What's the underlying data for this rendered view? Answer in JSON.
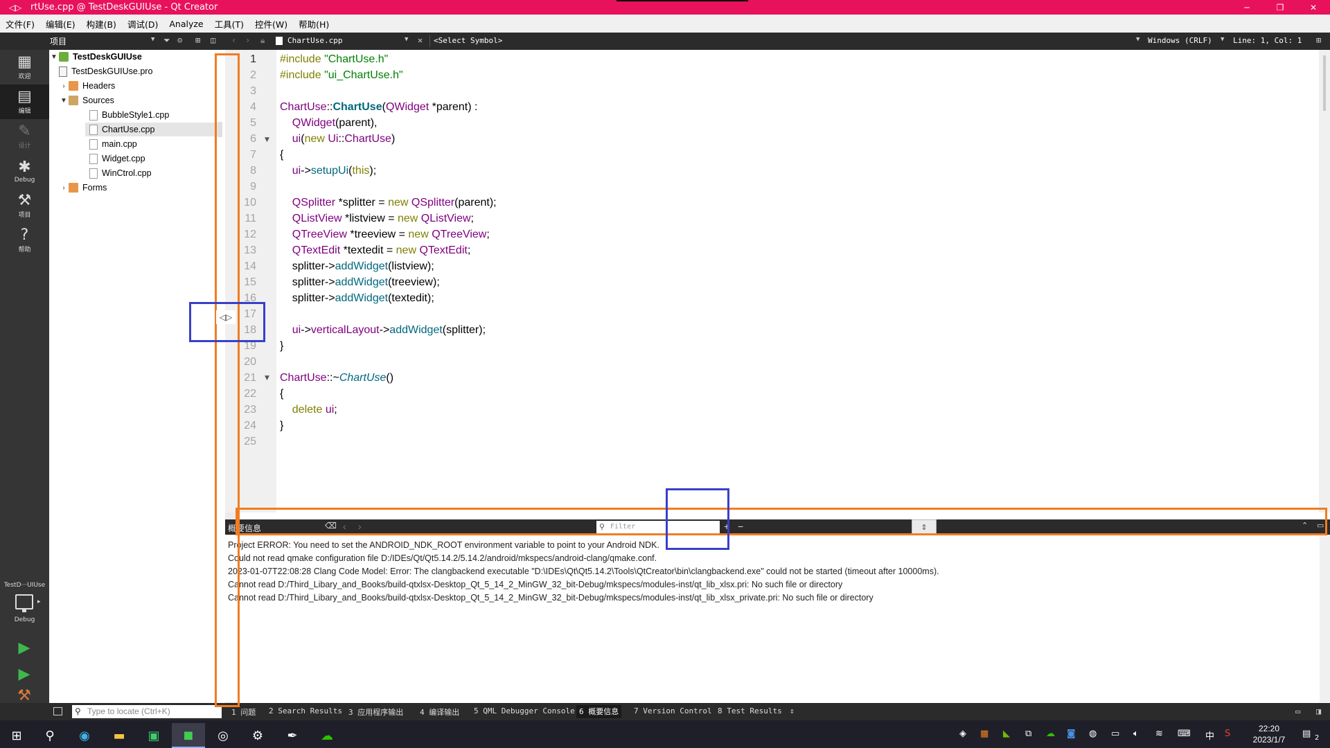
{
  "window": {
    "title": "rtUse.cpp @ TestDeskGUIUse - Qt Creator",
    "app_glyph": "◁▷",
    "minimize": "─",
    "maximize": "❐",
    "close": "✕"
  },
  "menubar": [
    "文件(F)",
    "编辑(E)",
    "构建(B)",
    "调试(D)",
    "Analyze",
    "工具(T)",
    "控件(W)",
    "帮助(H)"
  ],
  "toolbar": {
    "project_combo": "项目",
    "file_combo": "ChartUse.cpp",
    "symbol_combo": "<Select Symbol>",
    "line_ending": "Windows (CRLF)",
    "line_col": "Line: 1, Col: 1"
  },
  "modes": [
    {
      "label": "欢迎",
      "icon": "grid-icon",
      "glyph": "▦"
    },
    {
      "label": "编辑",
      "icon": "edit-doc-icon",
      "glyph": "▤"
    },
    {
      "label": "设计",
      "icon": "pencil-icon",
      "glyph": "✎"
    },
    {
      "label": "Debug",
      "icon": "bug-icon",
      "glyph": "✱"
    },
    {
      "label": "项目",
      "icon": "wrench-icon",
      "glyph": "⚒"
    },
    {
      "label": "帮助",
      "icon": "help-icon",
      "glyph": "?"
    }
  ],
  "kit": {
    "name": "TestD···UIUse",
    "build": "Debug"
  },
  "tree": {
    "project": "TestDeskGUIUse",
    "pro_file": "TestDeskGUIUse.pro",
    "headers": "Headers",
    "sources": "Sources",
    "files": [
      "BubbleStyle1.cpp",
      "ChartUse.cpp",
      "main.cpp",
      "Widget.cpp",
      "WinCtrol.cpp"
    ],
    "forms": "Forms"
  },
  "editor": {
    "line_numbers": [
      "1",
      "2",
      "3",
      "4",
      "5",
      "6",
      "7",
      "8",
      "9",
      "10",
      "11",
      "12",
      "13",
      "14",
      "15",
      "16",
      "17",
      "18",
      "19",
      "20",
      "21",
      "22",
      "23",
      "24",
      "25"
    ],
    "current_line": 1
  },
  "output": {
    "title": "概要信息",
    "filter_placeholder": "Filter",
    "lines": [
      "Project ERROR: You need to set the ANDROID_NDK_ROOT environment variable to point to your Android NDK.",
      "Could not read qmake configuration file D:/IDEs/Qt/Qt5.14.2/5.14.2/android/mkspecs/android-clang/qmake.conf.",
      "2023-01-07T22:08:28 Clang Code Model: Error: The clangbackend executable \"D:\\IDEs\\Qt\\Qt5.14.2\\Tools\\QtCreator\\bin\\clangbackend.exe\" could not be started (timeout after 10000ms).",
      "Cannot read D:/Third_Libary_and_Books/build-qtxlsx-Desktop_Qt_5_14_2_MinGW_32_bit-Debug/mkspecs/modules-inst/qt_lib_xlsx.pri: No such file or directory",
      "Cannot read D:/Third_Libary_and_Books/build-qtxlsx-Desktop_Qt_5_14_2_MinGW_32_bit-Debug/mkspecs/modules-inst/qt_lib_xlsx_private.pri: No such file or directory"
    ]
  },
  "bottom": {
    "locate_placeholder": "Type to locate (Ctrl+K)",
    "tabs": [
      "1 问题",
      "2 Search Results",
      "3 应用程序输出",
      "4 编译输出",
      "5 QML Debugger Console",
      "6 概要信息",
      "7 Version Control",
      "8 Test Results"
    ],
    "active_tab": 5
  },
  "taskbar": {
    "time": "22:20",
    "date": "2023/1/7",
    "ime": "中",
    "notifications": "2"
  },
  "colors": {
    "titlebar": "#e8115b",
    "dark_panel": "#2b2b2b",
    "annotation_orange": "#f07c22",
    "annotation_blue": "#3a3fc8"
  }
}
